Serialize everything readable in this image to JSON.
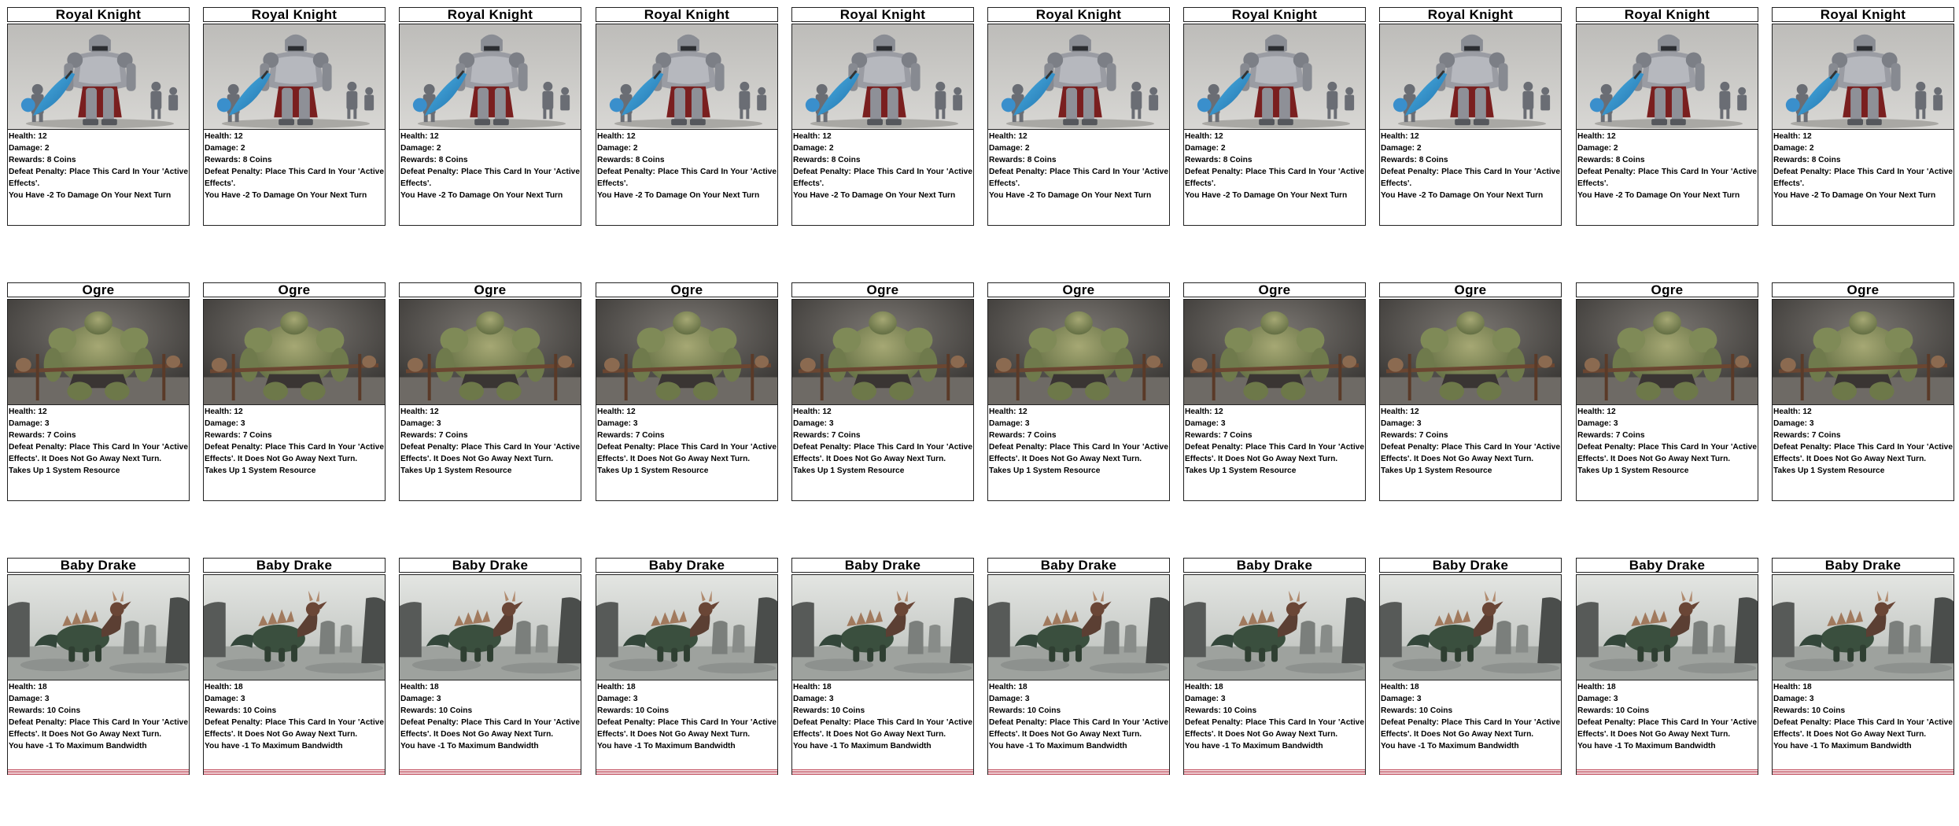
{
  "cards": [
    {
      "row": "knight",
      "title": "Royal Knight",
      "health": "Health: 12",
      "damage": "Damage: 2",
      "rewards": "Rewards: 8 Coins",
      "penalty": "Defeat Penalty: Place This Card In Your 'Active Effects'.",
      "effect": "You Have -2 To Damage On Your Next Turn",
      "art": "royal-knight-illustration"
    },
    {
      "row": "ogre",
      "title": "Ogre",
      "health": "Health: 12",
      "damage": "Damage: 3",
      "rewards": "Rewards: 7 Coins",
      "penalty": "Defeat Penalty: Place This Card In Your 'Active Effects'. It Does Not Go Away Next Turn.",
      "effect": "Takes Up 1 System Resource",
      "art": "ogre-illustration"
    },
    {
      "row": "drake",
      "title": "Baby Drake",
      "health": "Health: 18",
      "damage": "Damage: 3",
      "rewards": "Rewards: 10 Coins",
      "penalty": "Defeat Penalty: Place This Card In Your 'Active Effects'. It Does Not Go Away Next Turn.",
      "effect": "You have -1 To Maximum Bandwidth",
      "art": "baby-drake-illustration"
    }
  ],
  "copies_per_row": 10,
  "colors": {
    "border": "#222222",
    "knight_bg": "#c9c8c5",
    "ogre_bg": "#4a4744",
    "drake_bg": "#cfd2cf",
    "stripe": "#c04c5c"
  }
}
